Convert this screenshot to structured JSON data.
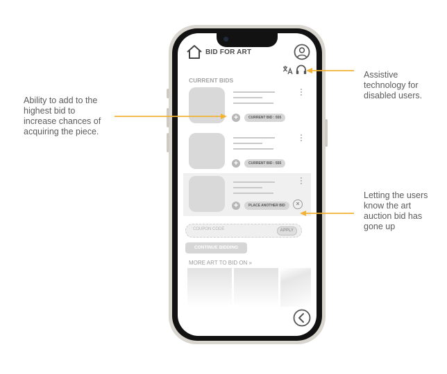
{
  "app": {
    "title": "BID FOR ART",
    "icons": {
      "home": "home-icon",
      "profile": "user-circle-icon",
      "translate": "translate-icon",
      "accessibility": "headset-icon",
      "back": "chevron-left-icon"
    }
  },
  "sections": {
    "current_bids": "CURRENT BIDS",
    "more_art": "MORE ART TO BID ON »"
  },
  "bids": [
    {
      "pill_label": "CURRENT BID : 555",
      "action_icon": "plus-icon"
    },
    {
      "pill_label": "CURRENT BID : 555",
      "action_icon": "plus-icon"
    },
    {
      "pill_label": "PLACE ANOTHER BID",
      "action_icon": "plus-icon",
      "alert_icon": "close-circle-icon"
    }
  ],
  "coupon": {
    "placeholder": "COUPON CODE",
    "apply_label": "APPLY"
  },
  "continue_label": "CONTINUE BIDDING",
  "annotations": {
    "add_bid": "Ability to add to the highest bid to increase chances of acquiring the piece.",
    "assistive": "Assistive technology for disabled users.",
    "bid_up": "Letting the users know the art auction bid has gone up"
  },
  "colors": {
    "arrow": "#f2b233",
    "wireframe_gray": "#d9d9d9",
    "text_gray": "#5a5a5a"
  }
}
